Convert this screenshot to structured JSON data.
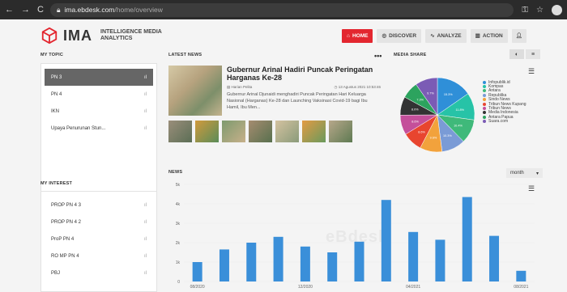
{
  "browser": {
    "url_domain": "ima.ebdesk.com",
    "url_path": "/home/overview"
  },
  "header": {
    "logo_text": "IMA",
    "logo_subtitle_1": "INTELLIGENCE MEDIA",
    "logo_subtitle_2": "ANALYTICS",
    "nav": [
      {
        "label": "HOME",
        "icon": "home-icon",
        "active": true
      },
      {
        "label": "DISCOVER",
        "icon": "compass-icon",
        "active": false
      },
      {
        "label": "ANALYZE",
        "icon": "analyze-icon",
        "active": false
      },
      {
        "label": "ACTION",
        "icon": "bar-chart-icon",
        "active": false
      }
    ],
    "accent_color": "#e3262f"
  },
  "sidebar": {
    "my_topic_label": "MY TOPIC",
    "topics": [
      {
        "label": "PN 3",
        "selected": true
      },
      {
        "label": "PN 4",
        "selected": false
      },
      {
        "label": "IKN",
        "selected": false
      },
      {
        "label": "Upaya Penurunan Stun...",
        "selected": false
      }
    ],
    "my_interest_label": "MY INTEREST",
    "interests": [
      {
        "label": "PROP PN 4 3"
      },
      {
        "label": "PROP PN 4 2"
      },
      {
        "label": "ProP PN 4"
      },
      {
        "label": "RO MP PN 4"
      },
      {
        "label": "PBJ"
      }
    ]
  },
  "latest_news": {
    "label": "LATEST NEWS",
    "more": "•••",
    "title": "Gubernur Arinal Hadiri Puncak Peringatan Harganas Ke-28",
    "source": "Harian Pelita",
    "timestamp": "13 Agustus 2021 10:53:46",
    "description": "Gubernur Arinal Djunaidi menghadiri Puncak Peringatan Hari Keluarga Nasional (Harganas) Ke-28 dan Launching Vaksinasi Covid-19 bagi Ibu Hamil, Ibu Men..."
  },
  "media_share": {
    "label": "MEDIA SHARE",
    "tab_pie": "◐",
    "tab_list": "≡",
    "legend": [
      {
        "name": "Infopublik.id",
        "color": "#2f8fd8",
        "value": 15.3
      },
      {
        "name": "Kompas",
        "color": "#27c3a7",
        "value": 11.8
      },
      {
        "name": "Antara",
        "color": "#3fb97a",
        "value": 10.4
      },
      {
        "name": "Republika",
        "color": "#7a9bd6",
        "value": 10.3
      },
      {
        "name": "Sindo News",
        "color": "#f2a23c",
        "value": 9.6
      },
      {
        "name": "Tribun News Kupang",
        "color": "#e8452f",
        "value": 8.6
      },
      {
        "name": "Tribun News",
        "color": "#c44f9a",
        "value": 8.6
      },
      {
        "name": "Media Indonesia",
        "color": "#333333",
        "value": 8.0
      },
      {
        "name": "Antara Papua",
        "color": "#2ca35e",
        "value": 7.3
      },
      {
        "name": "Suara.com",
        "color": "#7b5bb5",
        "value": 9.7
      }
    ]
  },
  "news_chart": {
    "label": "NEWS",
    "period": "month",
    "watermark": "eBdesk"
  },
  "chart_data": {
    "type": "bar",
    "categories": [
      "08/2020",
      "09/2020",
      "10/2020",
      "11/2020",
      "12/2020",
      "01/2021",
      "02/2021",
      "03/2021",
      "04/2021",
      "05/2021",
      "06/2021",
      "07/2021",
      "08/2021"
    ],
    "values": [
      1000,
      1650,
      2000,
      2300,
      1800,
      1500,
      2050,
      4200,
      2550,
      2150,
      4350,
      2350,
      550
    ],
    "ylim": [
      0,
      5000
    ],
    "yticks": [
      "0",
      "1k",
      "2k",
      "3k",
      "4k",
      "5k"
    ],
    "xtick_labels": [
      "08/2020",
      "12/2020",
      "04/2021",
      "08/2021"
    ],
    "color": "#3a8fd9"
  }
}
